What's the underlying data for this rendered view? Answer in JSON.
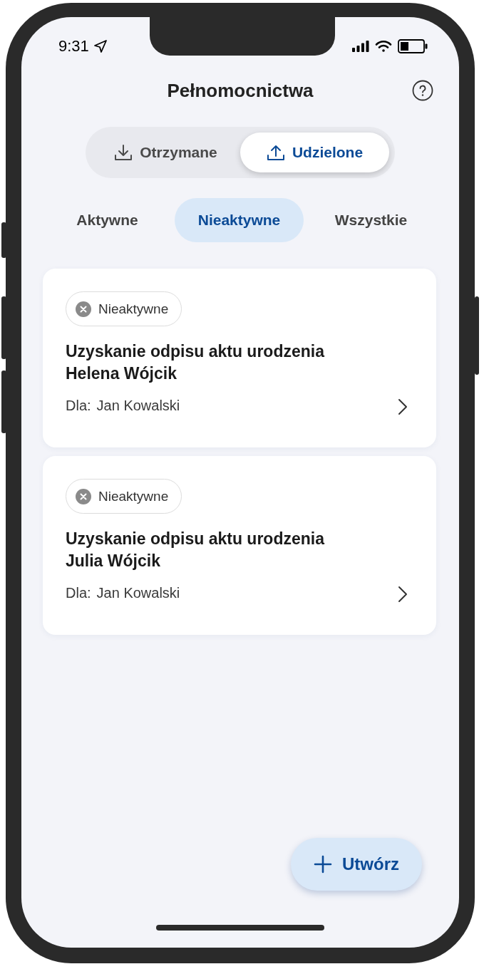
{
  "status_bar": {
    "time": "9:31"
  },
  "header": {
    "title": "Pełnomocnictwa"
  },
  "segments": [
    {
      "label": "Otrzymane",
      "selected": false
    },
    {
      "label": "Udzielone",
      "selected": true
    }
  ],
  "filters": [
    {
      "label": "Aktywne",
      "selected": false
    },
    {
      "label": "Nieaktywne",
      "selected": true
    },
    {
      "label": "Wszystkie",
      "selected": false
    }
  ],
  "cards": [
    {
      "status": "Nieaktywne",
      "title": "Uzyskanie odpisu aktu urodzenia\nHelena Wójcik",
      "for_label": "Dla:",
      "for_name": "Jan Kowalski"
    },
    {
      "status": "Nieaktywne",
      "title": "Uzyskanie odpisu aktu urodzenia\nJulia Wójcik",
      "for_label": "Dla:",
      "for_name": "Jan Kowalski"
    }
  ],
  "fab": {
    "label": "Utwórz"
  }
}
